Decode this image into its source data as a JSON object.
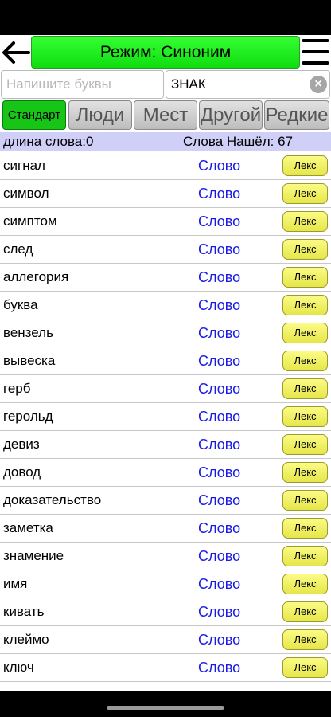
{
  "header": {
    "title": "Режим: Синоним",
    "back_icon": "arrow-left-icon",
    "menu_icon": "hamburger-menu-icon",
    "title_color": "#22ee22"
  },
  "search": {
    "letters_placeholder": "Напишите буквы",
    "letters_value": "",
    "word_value": "ЗНАК",
    "clear_icon": "close-circle-icon"
  },
  "tabs": [
    {
      "label": "Стандарт",
      "active": true
    },
    {
      "label": "Люди",
      "active": false
    },
    {
      "label": "Мест",
      "active": false
    },
    {
      "label": "Другой",
      "active": false
    },
    {
      "label": "Редкие",
      "active": false
    }
  ],
  "info": {
    "length_label": "длина слова:0",
    "found_label": "Слова Нашёл: 67"
  },
  "list": {
    "link_label": "Слово",
    "lex_label": "Лекс",
    "items": [
      "сигнал",
      "символ",
      "симптом",
      "след",
      "аллегория",
      "буква",
      "вензель",
      "вывеска",
      "герб",
      "герольд",
      "девиз",
      "довод",
      "доказательство",
      "заметка",
      "знамение",
      "имя",
      "кивать",
      "клеймо",
      "ключ"
    ]
  }
}
